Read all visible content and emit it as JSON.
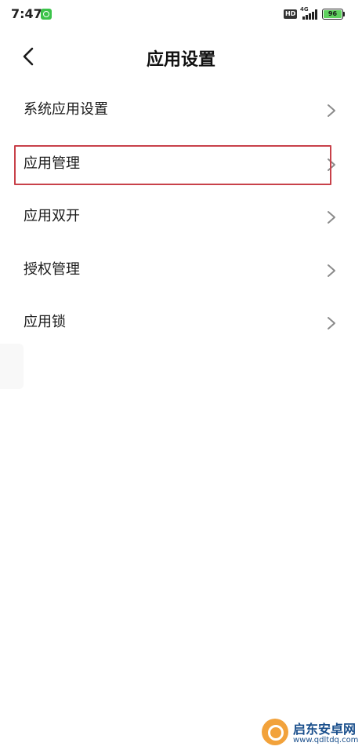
{
  "status_bar": {
    "time": "7:47",
    "hd_label": "HD",
    "network_label": "4G",
    "battery_level": "96"
  },
  "header": {
    "title": "应用设置"
  },
  "menu": {
    "items": [
      {
        "label": "系统应用设置"
      },
      {
        "label": "应用管理",
        "highlighted": true
      },
      {
        "label": "应用双开"
      },
      {
        "label": "授权管理"
      },
      {
        "label": "应用锁"
      }
    ]
  },
  "watermark": {
    "title": "启东安卓网",
    "url": "www.qdltdq.com"
  },
  "colors": {
    "highlight_border": "#c8414a",
    "battery_fill": "#5ed15e",
    "status_app_icon": "#3bc34a"
  },
  "icons": [
    "back-arrow-icon",
    "chevron-right-icon",
    "signal-icon",
    "battery-icon",
    "wechat-icon"
  ]
}
